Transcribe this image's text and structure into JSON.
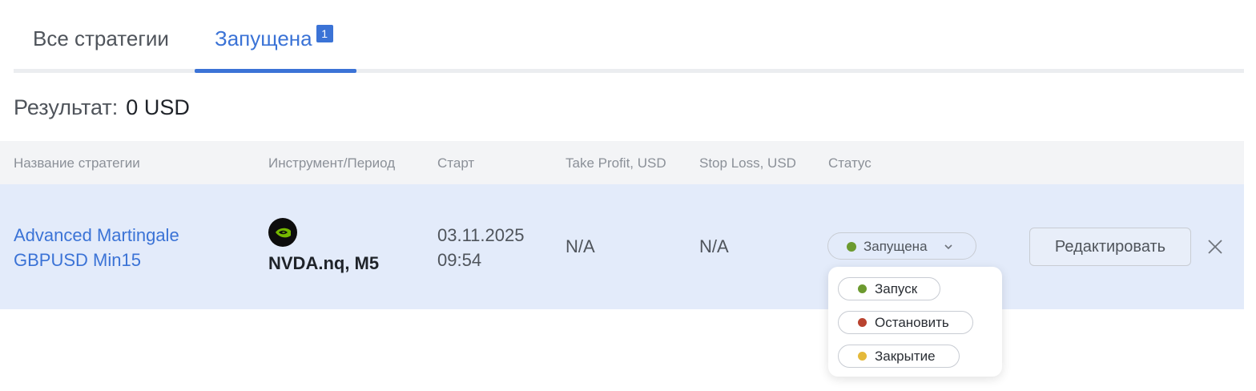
{
  "tabs": [
    {
      "label": "Все стратегии"
    },
    {
      "label": "Запущена",
      "badge": "1"
    }
  ],
  "result": {
    "label": "Результат:",
    "value": "0 USD"
  },
  "table": {
    "headers": [
      "Название стратегии",
      "Инструмент/Период",
      "Старт",
      "Take Profit, USD",
      "Stop Loss, USD",
      "Статус"
    ],
    "row": {
      "name_line1": "Advanced Martingale",
      "name_line2": "GBPUSD Min15",
      "instrument_icon": "nvidia-logo-icon",
      "instrument": "NVDA.nq, M5",
      "start_date": "03.11.2025",
      "start_time": "09:54",
      "take_profit": "N/A",
      "stop_loss": "N/A",
      "status": "Запущена",
      "edit_label": "Редактировать"
    }
  },
  "status_menu": {
    "options": [
      {
        "label": "Запуск",
        "color": "#6c9a2f"
      },
      {
        "label": "Остановить",
        "color": "#b9432f"
      },
      {
        "label": "Закрытие",
        "color": "#e4b93a"
      }
    ]
  },
  "colors": {
    "accent": "#3b73d6",
    "status_running": "#6c9a2f",
    "row_selected": "#e3ebfa"
  }
}
